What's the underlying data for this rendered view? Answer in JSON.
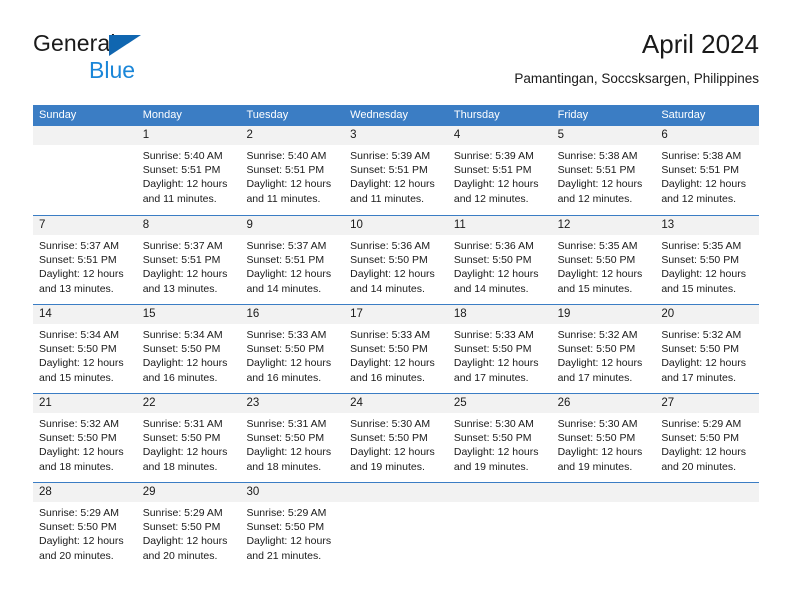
{
  "brand": {
    "word1": "General",
    "word2": "Blue",
    "triangle_color": "#1066b0",
    "word2_color": "#1a86d8"
  },
  "header": {
    "title": "April 2024",
    "subtitle": "Pamantingan, Soccsksargen, Philippines"
  },
  "theme": {
    "header_blue": "#3b7dc4",
    "day_band_gray": "#f2f2f2",
    "text": "#1a1a1a"
  },
  "weekdays": [
    "Sunday",
    "Monday",
    "Tuesday",
    "Wednesday",
    "Thursday",
    "Friday",
    "Saturday"
  ],
  "weeks": [
    [
      {
        "day": "",
        "sunrise": "",
        "sunset": "",
        "daylight1": "",
        "daylight2": ""
      },
      {
        "day": "1",
        "sunrise": "Sunrise: 5:40 AM",
        "sunset": "Sunset: 5:51 PM",
        "daylight1": "Daylight: 12 hours",
        "daylight2": "and 11 minutes."
      },
      {
        "day": "2",
        "sunrise": "Sunrise: 5:40 AM",
        "sunset": "Sunset: 5:51 PM",
        "daylight1": "Daylight: 12 hours",
        "daylight2": "and 11 minutes."
      },
      {
        "day": "3",
        "sunrise": "Sunrise: 5:39 AM",
        "sunset": "Sunset: 5:51 PM",
        "daylight1": "Daylight: 12 hours",
        "daylight2": "and 11 minutes."
      },
      {
        "day": "4",
        "sunrise": "Sunrise: 5:39 AM",
        "sunset": "Sunset: 5:51 PM",
        "daylight1": "Daylight: 12 hours",
        "daylight2": "and 12 minutes."
      },
      {
        "day": "5",
        "sunrise": "Sunrise: 5:38 AM",
        "sunset": "Sunset: 5:51 PM",
        "daylight1": "Daylight: 12 hours",
        "daylight2": "and 12 minutes."
      },
      {
        "day": "6",
        "sunrise": "Sunrise: 5:38 AM",
        "sunset": "Sunset: 5:51 PM",
        "daylight1": "Daylight: 12 hours",
        "daylight2": "and 12 minutes."
      }
    ],
    [
      {
        "day": "7",
        "sunrise": "Sunrise: 5:37 AM",
        "sunset": "Sunset: 5:51 PM",
        "daylight1": "Daylight: 12 hours",
        "daylight2": "and 13 minutes."
      },
      {
        "day": "8",
        "sunrise": "Sunrise: 5:37 AM",
        "sunset": "Sunset: 5:51 PM",
        "daylight1": "Daylight: 12 hours",
        "daylight2": "and 13 minutes."
      },
      {
        "day": "9",
        "sunrise": "Sunrise: 5:37 AM",
        "sunset": "Sunset: 5:51 PM",
        "daylight1": "Daylight: 12 hours",
        "daylight2": "and 14 minutes."
      },
      {
        "day": "10",
        "sunrise": "Sunrise: 5:36 AM",
        "sunset": "Sunset: 5:50 PM",
        "daylight1": "Daylight: 12 hours",
        "daylight2": "and 14 minutes."
      },
      {
        "day": "11",
        "sunrise": "Sunrise: 5:36 AM",
        "sunset": "Sunset: 5:50 PM",
        "daylight1": "Daylight: 12 hours",
        "daylight2": "and 14 minutes."
      },
      {
        "day": "12",
        "sunrise": "Sunrise: 5:35 AM",
        "sunset": "Sunset: 5:50 PM",
        "daylight1": "Daylight: 12 hours",
        "daylight2": "and 15 minutes."
      },
      {
        "day": "13",
        "sunrise": "Sunrise: 5:35 AM",
        "sunset": "Sunset: 5:50 PM",
        "daylight1": "Daylight: 12 hours",
        "daylight2": "and 15 minutes."
      }
    ],
    [
      {
        "day": "14",
        "sunrise": "Sunrise: 5:34 AM",
        "sunset": "Sunset: 5:50 PM",
        "daylight1": "Daylight: 12 hours",
        "daylight2": "and 15 minutes."
      },
      {
        "day": "15",
        "sunrise": "Sunrise: 5:34 AM",
        "sunset": "Sunset: 5:50 PM",
        "daylight1": "Daylight: 12 hours",
        "daylight2": "and 16 minutes."
      },
      {
        "day": "16",
        "sunrise": "Sunrise: 5:33 AM",
        "sunset": "Sunset: 5:50 PM",
        "daylight1": "Daylight: 12 hours",
        "daylight2": "and 16 minutes."
      },
      {
        "day": "17",
        "sunrise": "Sunrise: 5:33 AM",
        "sunset": "Sunset: 5:50 PM",
        "daylight1": "Daylight: 12 hours",
        "daylight2": "and 16 minutes."
      },
      {
        "day": "18",
        "sunrise": "Sunrise: 5:33 AM",
        "sunset": "Sunset: 5:50 PM",
        "daylight1": "Daylight: 12 hours",
        "daylight2": "and 17 minutes."
      },
      {
        "day": "19",
        "sunrise": "Sunrise: 5:32 AM",
        "sunset": "Sunset: 5:50 PM",
        "daylight1": "Daylight: 12 hours",
        "daylight2": "and 17 minutes."
      },
      {
        "day": "20",
        "sunrise": "Sunrise: 5:32 AM",
        "sunset": "Sunset: 5:50 PM",
        "daylight1": "Daylight: 12 hours",
        "daylight2": "and 17 minutes."
      }
    ],
    [
      {
        "day": "21",
        "sunrise": "Sunrise: 5:32 AM",
        "sunset": "Sunset: 5:50 PM",
        "daylight1": "Daylight: 12 hours",
        "daylight2": "and 18 minutes."
      },
      {
        "day": "22",
        "sunrise": "Sunrise: 5:31 AM",
        "sunset": "Sunset: 5:50 PM",
        "daylight1": "Daylight: 12 hours",
        "daylight2": "and 18 minutes."
      },
      {
        "day": "23",
        "sunrise": "Sunrise: 5:31 AM",
        "sunset": "Sunset: 5:50 PM",
        "daylight1": "Daylight: 12 hours",
        "daylight2": "and 18 minutes."
      },
      {
        "day": "24",
        "sunrise": "Sunrise: 5:30 AM",
        "sunset": "Sunset: 5:50 PM",
        "daylight1": "Daylight: 12 hours",
        "daylight2": "and 19 minutes."
      },
      {
        "day": "25",
        "sunrise": "Sunrise: 5:30 AM",
        "sunset": "Sunset: 5:50 PM",
        "daylight1": "Daylight: 12 hours",
        "daylight2": "and 19 minutes."
      },
      {
        "day": "26",
        "sunrise": "Sunrise: 5:30 AM",
        "sunset": "Sunset: 5:50 PM",
        "daylight1": "Daylight: 12 hours",
        "daylight2": "and 19 minutes."
      },
      {
        "day": "27",
        "sunrise": "Sunrise: 5:29 AM",
        "sunset": "Sunset: 5:50 PM",
        "daylight1": "Daylight: 12 hours",
        "daylight2": "and 20 minutes."
      }
    ],
    [
      {
        "day": "28",
        "sunrise": "Sunrise: 5:29 AM",
        "sunset": "Sunset: 5:50 PM",
        "daylight1": "Daylight: 12 hours",
        "daylight2": "and 20 minutes."
      },
      {
        "day": "29",
        "sunrise": "Sunrise: 5:29 AM",
        "sunset": "Sunset: 5:50 PM",
        "daylight1": "Daylight: 12 hours",
        "daylight2": "and 20 minutes."
      },
      {
        "day": "30",
        "sunrise": "Sunrise: 5:29 AM",
        "sunset": "Sunset: 5:50 PM",
        "daylight1": "Daylight: 12 hours",
        "daylight2": "and 21 minutes."
      },
      {
        "day": "",
        "sunrise": "",
        "sunset": "",
        "daylight1": "",
        "daylight2": ""
      },
      {
        "day": "",
        "sunrise": "",
        "sunset": "",
        "daylight1": "",
        "daylight2": ""
      },
      {
        "day": "",
        "sunrise": "",
        "sunset": "",
        "daylight1": "",
        "daylight2": ""
      },
      {
        "day": "",
        "sunrise": "",
        "sunset": "",
        "daylight1": "",
        "daylight2": ""
      }
    ]
  ]
}
